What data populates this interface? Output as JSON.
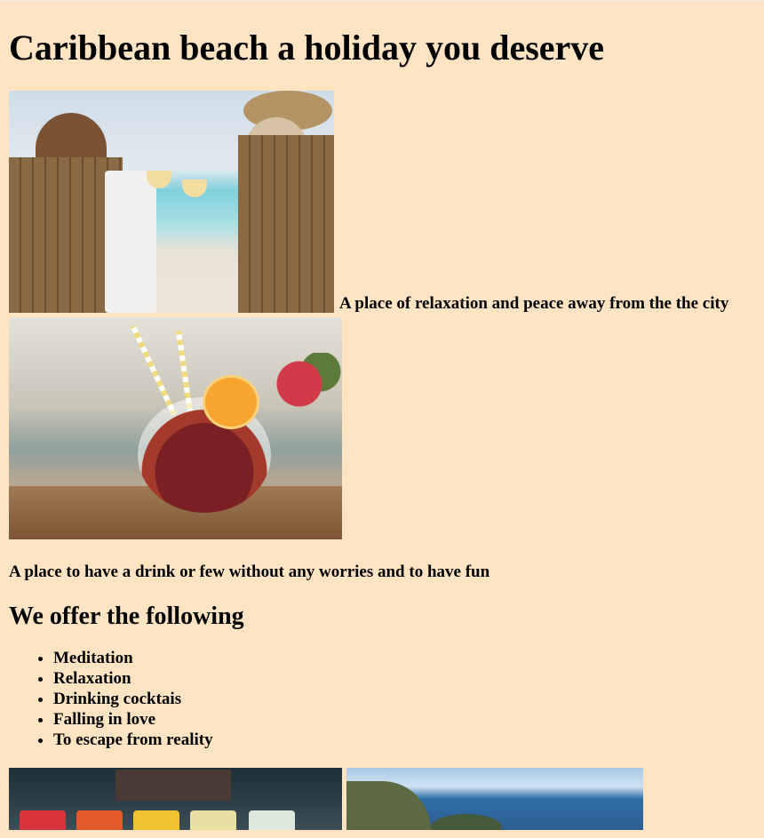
{
  "page": {
    "title": "Caribbean beach a holiday you deserve",
    "section1_caption": "A place of relaxation and peace away from the the city",
    "section2_caption": "A place to have a drink or few without any worries and to have fun",
    "offers_heading": "We offer the following",
    "offers": [
      "Meditation",
      "Relaxation",
      "Drinking cocktais",
      "Falling in love",
      "To escape from reality"
    ]
  },
  "images": {
    "beach": "beach-chairs-photo",
    "drink": "sangria-drink-photo",
    "cocktails": "cocktails-bar-photo",
    "coast": "coastline-photo"
  },
  "colors": {
    "background": "#ffe4c4",
    "text": "#000000"
  }
}
